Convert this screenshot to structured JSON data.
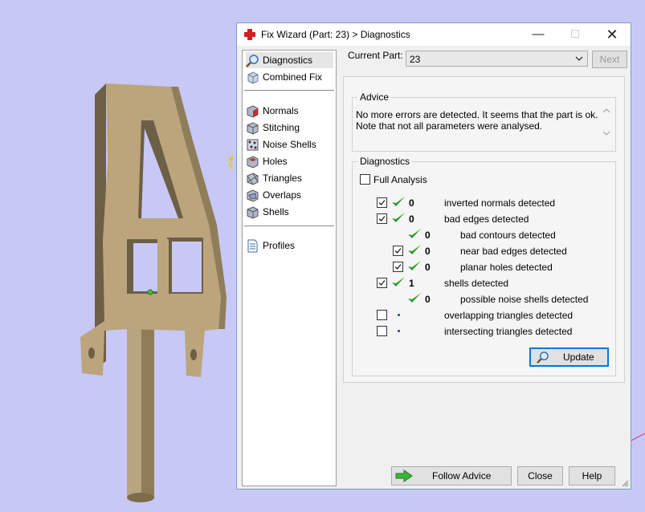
{
  "window": {
    "title": "Fix Wizard (Part: 23) > Diagnostics",
    "minimize": "—",
    "maximize": "☐",
    "close": "✕"
  },
  "nav": {
    "items": [
      {
        "label": "Diagnostics",
        "icon": "magnifier-icon",
        "selected": true
      },
      {
        "label": "Combined Fix",
        "icon": "combined-fix-icon",
        "selected": false
      },
      {
        "label": "Normals",
        "icon": "normals-cube-icon",
        "selected": false
      },
      {
        "label": "Stitching",
        "icon": "stitching-cube-icon",
        "selected": false
      },
      {
        "label": "Noise Shells",
        "icon": "noise-shells-icon",
        "selected": false
      },
      {
        "label": "Holes",
        "icon": "holes-cube-icon",
        "selected": false
      },
      {
        "label": "Triangles",
        "icon": "triangles-cube-icon",
        "selected": false
      },
      {
        "label": "Overlaps",
        "icon": "overlaps-cube-icon",
        "selected": false
      },
      {
        "label": "Shells",
        "icon": "shells-cube-icon",
        "selected": false
      },
      {
        "label": "Profiles",
        "icon": "document-icon",
        "selected": false
      }
    ]
  },
  "current_part": {
    "label": "Current Part:",
    "value": "23",
    "next_label": "Next"
  },
  "advice": {
    "title": "Advice",
    "line1": "No more errors are detected. It seems that the part is ok.",
    "line2": "Note that not all parameters were analysed."
  },
  "diagnostics": {
    "title": "Diagnostics",
    "full_analysis_label": "Full Analysis",
    "full_analysis_checked": false,
    "rows": [
      {
        "checkbox": true,
        "checked": true,
        "status": "ok",
        "count": "0",
        "label": "inverted normals detected",
        "indent": 0
      },
      {
        "checkbox": true,
        "checked": true,
        "status": "ok",
        "count": "0",
        "label": "bad edges detected",
        "indent": 0
      },
      {
        "checkbox": false,
        "checked": false,
        "status": "ok",
        "count": "0",
        "label": "bad contours detected",
        "indent": 1
      },
      {
        "checkbox": true,
        "checked": true,
        "status": "ok",
        "count": "0",
        "label": "near bad edges detected",
        "indent": 1
      },
      {
        "checkbox": true,
        "checked": true,
        "status": "ok",
        "count": "0",
        "label": "planar holes detected",
        "indent": 1
      },
      {
        "checkbox": true,
        "checked": true,
        "status": "ok",
        "count": "1",
        "label": "shells detected",
        "indent": 0
      },
      {
        "checkbox": false,
        "checked": false,
        "status": "ok",
        "count": "0",
        "label": "possible noise shells detected",
        "indent": 1
      },
      {
        "checkbox": true,
        "checked": false,
        "status": "pending",
        "count": "",
        "label": "overlapping triangles detected",
        "indent": 0
      },
      {
        "checkbox": true,
        "checked": false,
        "status": "pending",
        "count": "",
        "label": "intersecting triangles detected",
        "indent": 0
      }
    ],
    "update_label": "Update"
  },
  "footer": {
    "follow_advice_label": "Follow Advice",
    "close_label": "Close",
    "help_label": "Help"
  },
  "colors": {
    "viewport_background": "#c8c8f6",
    "check_green": "#2e9a2e",
    "accent_blue": "#0078d7",
    "part_tan": "#bca57c"
  }
}
